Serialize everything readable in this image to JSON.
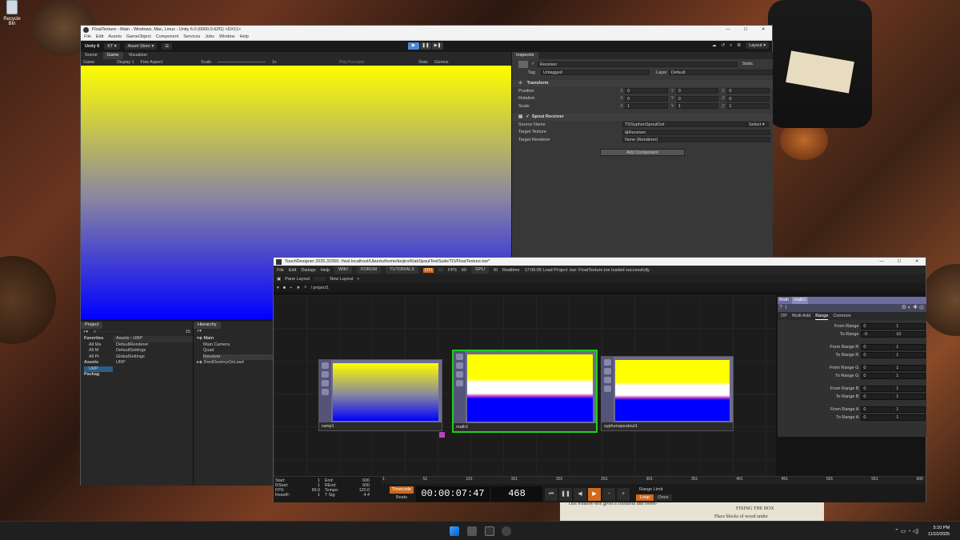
{
  "desktop": {
    "recycle_label": "Recycle Bin"
  },
  "unity": {
    "title": "FloatTexture - Main - Windows, Mac, Linux - Unity 6.0 (6000.0.62f1) <DX11>",
    "menu": [
      "File",
      "Edit",
      "Assets",
      "GameObject",
      "Component",
      "Services",
      "Jobs",
      "Window",
      "Help"
    ],
    "toolbar": {
      "brand": "Unity 6",
      "account": "KT ▾",
      "asset_store": "Asset Store ▾",
      "layout": "Layout ▾"
    },
    "view_tabs": [
      "Scene",
      "Game",
      "Visualizer"
    ],
    "gamebar": {
      "mode": "Game",
      "display": "Display 1",
      "aspect": "Free Aspect",
      "scale_label": "Scale",
      "scale_value": "1x",
      "play_focused": "Play Focused",
      "stats": "Stats",
      "gizmos": "Gizmos"
    },
    "inspector": {
      "tab": "Inspector",
      "object_name": "Receiver",
      "static": "Static",
      "tag_label": "Tag",
      "tag": "Untagged",
      "layer_label": "Layer",
      "layer": "Default",
      "transform": {
        "title": "Transform",
        "rows": [
          {
            "label": "Position",
            "x": "0",
            "y": "0",
            "z": "0"
          },
          {
            "label": "Rotation",
            "x": "0",
            "y": "0",
            "z": "0"
          },
          {
            "label": "Scale",
            "x": "1",
            "y": "1",
            "z": "1"
          }
        ]
      },
      "spout": {
        "title": "Spout Receiver",
        "rows": [
          {
            "label": "Source Name",
            "value": "TDSyphonSpoutOut",
            "extra": "Select ▾"
          },
          {
            "label": "Target Texture",
            "value": "⊞Receiver"
          },
          {
            "label": "Target Renderer",
            "value": "None (Renderer)"
          }
        ]
      },
      "add_component": "Add Component"
    },
    "project": {
      "tab": "Project",
      "breadcrumb_assets": "Assets",
      "breadcrumb_urp": "URP",
      "count": "15",
      "favorites": [
        "Favorites",
        "All Ma",
        "All M",
        "All Pr"
      ],
      "asset_tree": [
        "Assets",
        "URP",
        "Packag"
      ],
      "files": [
        "DefaultRenderer",
        "DefaultSettings",
        "GlobalSettings",
        "URP"
      ]
    },
    "hierarchy": {
      "tab": "Hierarchy",
      "scene": "Main",
      "items": [
        "Main Camera",
        "Quad",
        "Receiver"
      ],
      "dont_destroy": "DontDestroyOnLoad"
    }
  },
  "td": {
    "title": "TouchDesigner 2025.31550: //wsl.localhost/Ubuntu/home/keijiro/KlakSpoutTestSuite/TD/FloatTexture.toe*",
    "menu": [
      "File",
      "Edit",
      "Dialogs",
      "Help"
    ],
    "links": [
      "WIKI",
      "FORUM",
      "TUTORIALS"
    ],
    "opt": "OTI",
    "fps_label": "FPS",
    "fps": "60",
    "fps_dim": "60",
    "gpu": "GPU",
    "realtime": "Realtime",
    "status": "17:06:05 Load Project .toe: FloatTexture.toe loaded successfully.",
    "pane_layout": "Pane Layout",
    "new_layout": "New Layout",
    "path": "/ project1",
    "nodes": [
      {
        "name": "ramp1"
      },
      {
        "name": "math1"
      },
      {
        "name": "syphonspoutout1"
      }
    ],
    "params": {
      "type": "Math",
      "name": "math1",
      "tabs": [
        "OP",
        "Multi-Add",
        "Range",
        "Common"
      ],
      "rows": [
        {
          "k": "From Range",
          "a": "0",
          "b": "1"
        },
        {
          "k": "To Range",
          "a": "-5",
          "b": "10"
        },
        {
          "k": "From Range R",
          "a": "0",
          "b": "1"
        },
        {
          "k": "To Range R",
          "a": "0",
          "b": "1"
        },
        {
          "k": "From Range G",
          "a": "0",
          "b": "1"
        },
        {
          "k": "To Range G",
          "a": "0",
          "b": "1"
        },
        {
          "k": "From Range B",
          "a": "0",
          "b": "1"
        },
        {
          "k": "To Range B",
          "a": "0",
          "b": "1"
        },
        {
          "k": "From Range A",
          "a": "0",
          "b": "1"
        },
        {
          "k": "To Range A",
          "a": "0",
          "b": "1"
        }
      ]
    },
    "timeline": {
      "left": [
        {
          "k": "Start:",
          "v": "1"
        },
        {
          "k": "RStart:",
          "v": "1"
        },
        {
          "k": "FPS:",
          "v": "60.0"
        },
        {
          "k": "ResetF:",
          "v": "1"
        }
      ],
      "right": [
        {
          "k": "End:",
          "v": "600"
        },
        {
          "k": "REnd:",
          "v": "600"
        },
        {
          "k": "Tempo:",
          "v": "120.0"
        },
        {
          "k": "T Sig:",
          "v": "4    4"
        }
      ],
      "timecode": "Timecode",
      "beats": "Beats",
      "time": "00:00:07:47",
      "frame": "468",
      "range_limit": "Range Limit",
      "loop": "Loop",
      "once": "Once",
      "ticks": [
        "1",
        "51",
        "101",
        "151",
        "201",
        "251",
        "301",
        "351",
        "401",
        "451",
        "501",
        "551",
        "600"
      ]
    }
  },
  "taskbar": {
    "time": "5:10 PM",
    "date": "11/10/2025"
  },
  "book_text": [
    "This window-box gives a colourful and sweet-",
    "FIXING THE BOX",
    "Place blocks of wood under"
  ]
}
